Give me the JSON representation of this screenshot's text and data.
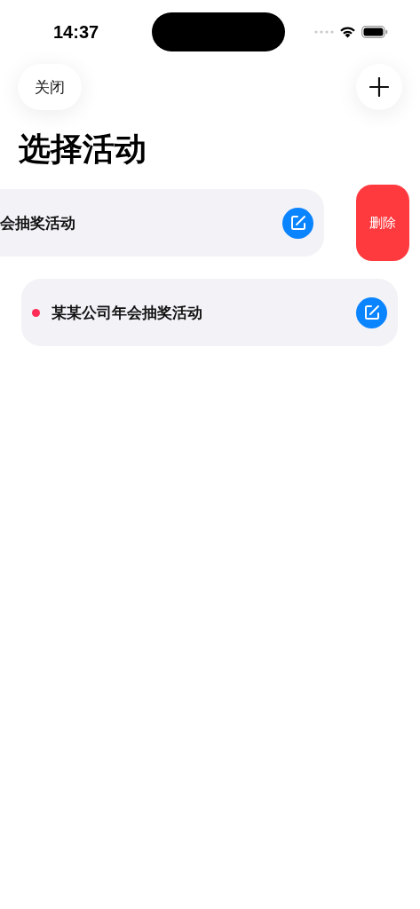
{
  "status_bar": {
    "time": "14:37"
  },
  "nav": {
    "close_label": "关闭"
  },
  "title": "选择活动",
  "rows": [
    {
      "name": "会抽奖活动",
      "swiped": true,
      "delete_label": "删除"
    },
    {
      "name": "某某公司年会抽奖活动",
      "swiped": false,
      "color": "#ff2d55"
    }
  ]
}
